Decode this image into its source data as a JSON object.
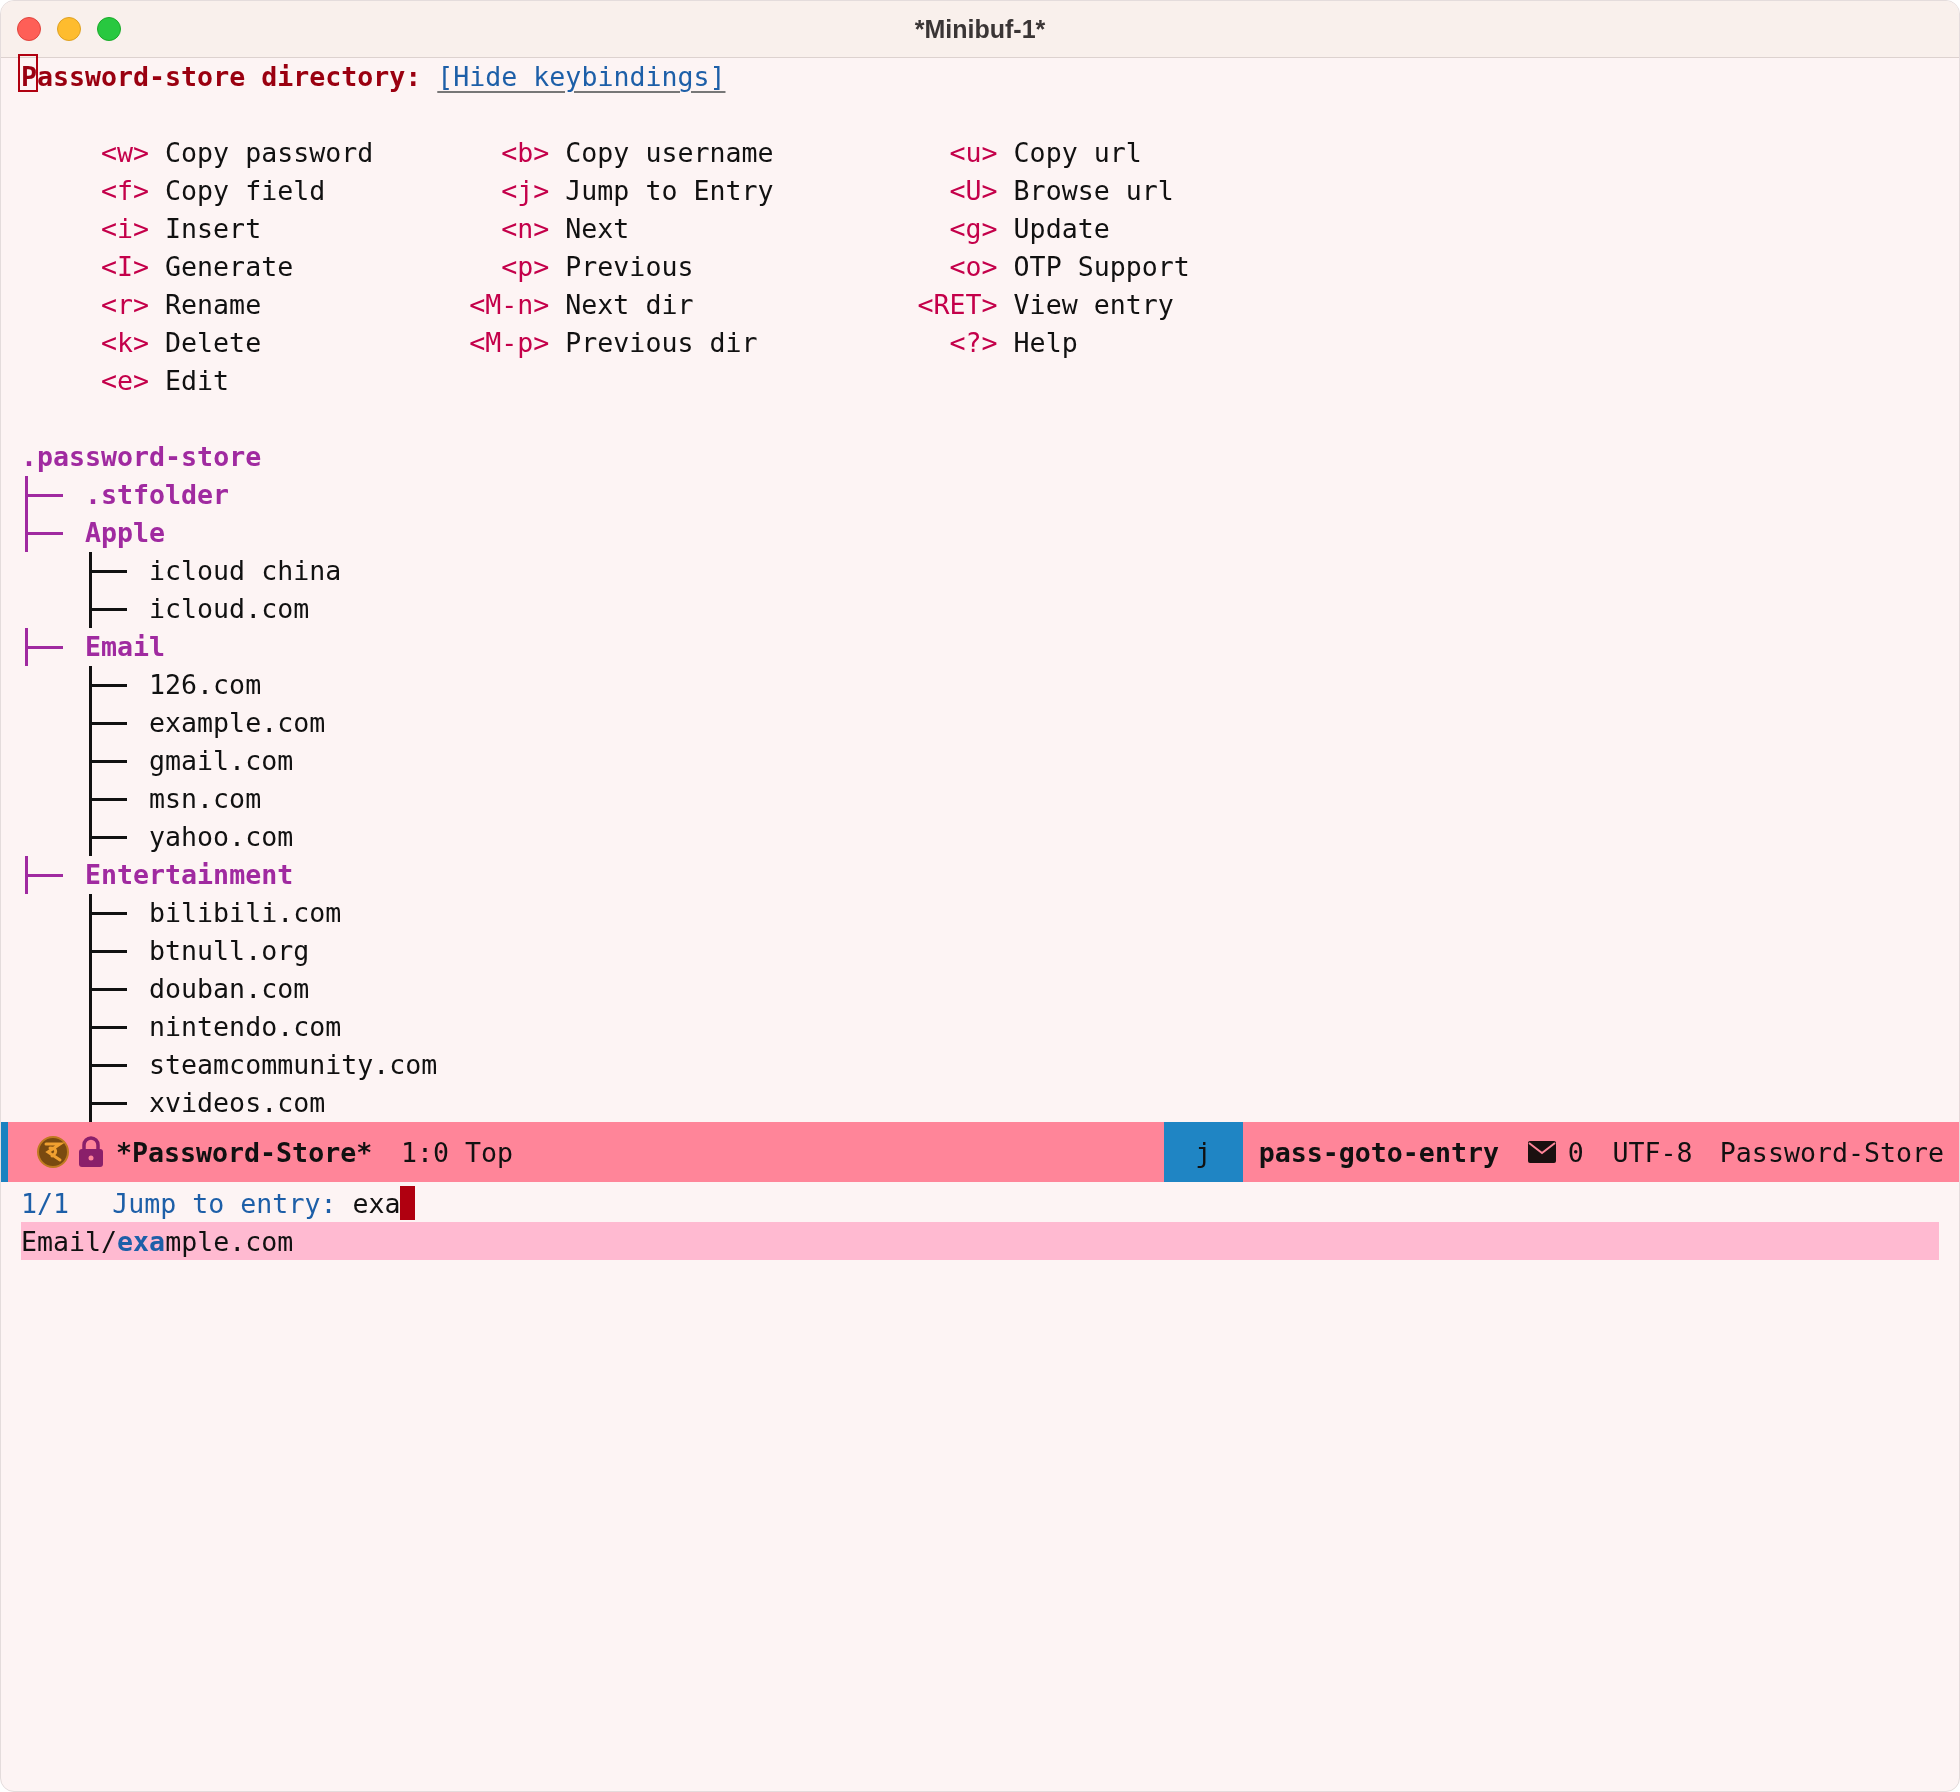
{
  "window": {
    "title": "*Minibuf-1*"
  },
  "header": {
    "label": "Password-store directory:",
    "link": "[Hide keybindings]"
  },
  "keybindings": [
    [
      {
        "key": "<w>",
        "action": "Copy password"
      },
      {
        "key": "<b>",
        "action": "Copy username"
      },
      {
        "key": "<u>",
        "action": "Copy url"
      }
    ],
    [
      {
        "key": "<f>",
        "action": "Copy field"
      },
      {
        "key": "<j>",
        "action": "Jump to Entry"
      },
      {
        "key": "<U>",
        "action": "Browse url"
      }
    ],
    [
      {
        "key": "<i>",
        "action": "Insert"
      },
      {
        "key": "<n>",
        "action": "Next"
      },
      {
        "key": "<g>",
        "action": "Update"
      }
    ],
    [
      {
        "key": "<I>",
        "action": "Generate"
      },
      {
        "key": "<p>",
        "action": "Previous"
      },
      {
        "key": "<o>",
        "action": "OTP Support"
      }
    ],
    [
      {
        "key": "<r>",
        "action": "Rename"
      },
      {
        "key": "<M-n>",
        "action": "Next dir"
      },
      {
        "key": "<RET>",
        "action": "View entry"
      }
    ],
    [
      {
        "key": "<k>",
        "action": "Delete"
      },
      {
        "key": "<M-p>",
        "action": "Previous dir"
      },
      {
        "key": "<?>",
        "action": "Help"
      }
    ],
    [
      {
        "key": "<e>",
        "action": "Edit"
      }
    ]
  ],
  "tree": {
    "root": ".password-store",
    "children": [
      {
        "name": ".stfolder",
        "kind": "dir"
      },
      {
        "name": "Apple",
        "kind": "dir",
        "children": [
          {
            "name": "icloud china",
            "kind": "file"
          },
          {
            "name": "icloud.com",
            "kind": "file"
          }
        ]
      },
      {
        "name": "Email",
        "kind": "dir",
        "children": [
          {
            "name": "126.com",
            "kind": "file"
          },
          {
            "name": "example.com",
            "kind": "file"
          },
          {
            "name": "gmail.com",
            "kind": "file"
          },
          {
            "name": "msn.com",
            "kind": "file"
          },
          {
            "name": "yahoo.com",
            "kind": "file"
          }
        ]
      },
      {
        "name": "Entertainment",
        "kind": "dir",
        "children": [
          {
            "name": "bilibili.com",
            "kind": "file"
          },
          {
            "name": "btnull.org",
            "kind": "file"
          },
          {
            "name": "douban.com",
            "kind": "file"
          },
          {
            "name": "nintendo.com",
            "kind": "file"
          },
          {
            "name": "steamcommunity.com",
            "kind": "file"
          },
          {
            "name": "xvideos.com",
            "kind": "file"
          }
        ]
      }
    ]
  },
  "mode_line": {
    "buffer": "*Password-Store*",
    "position": "1:0",
    "scroll": "Top",
    "key": "j",
    "command": "pass-goto-entry",
    "mail_count": "0",
    "encoding": "UTF-8",
    "mode": "Password-Store"
  },
  "minibuffer": {
    "count": "1/1",
    "prompt": "Jump to entry:",
    "input": "exa"
  },
  "completions": [
    {
      "text": "Email/**exa**mple.com",
      "selected": true
    }
  ]
}
